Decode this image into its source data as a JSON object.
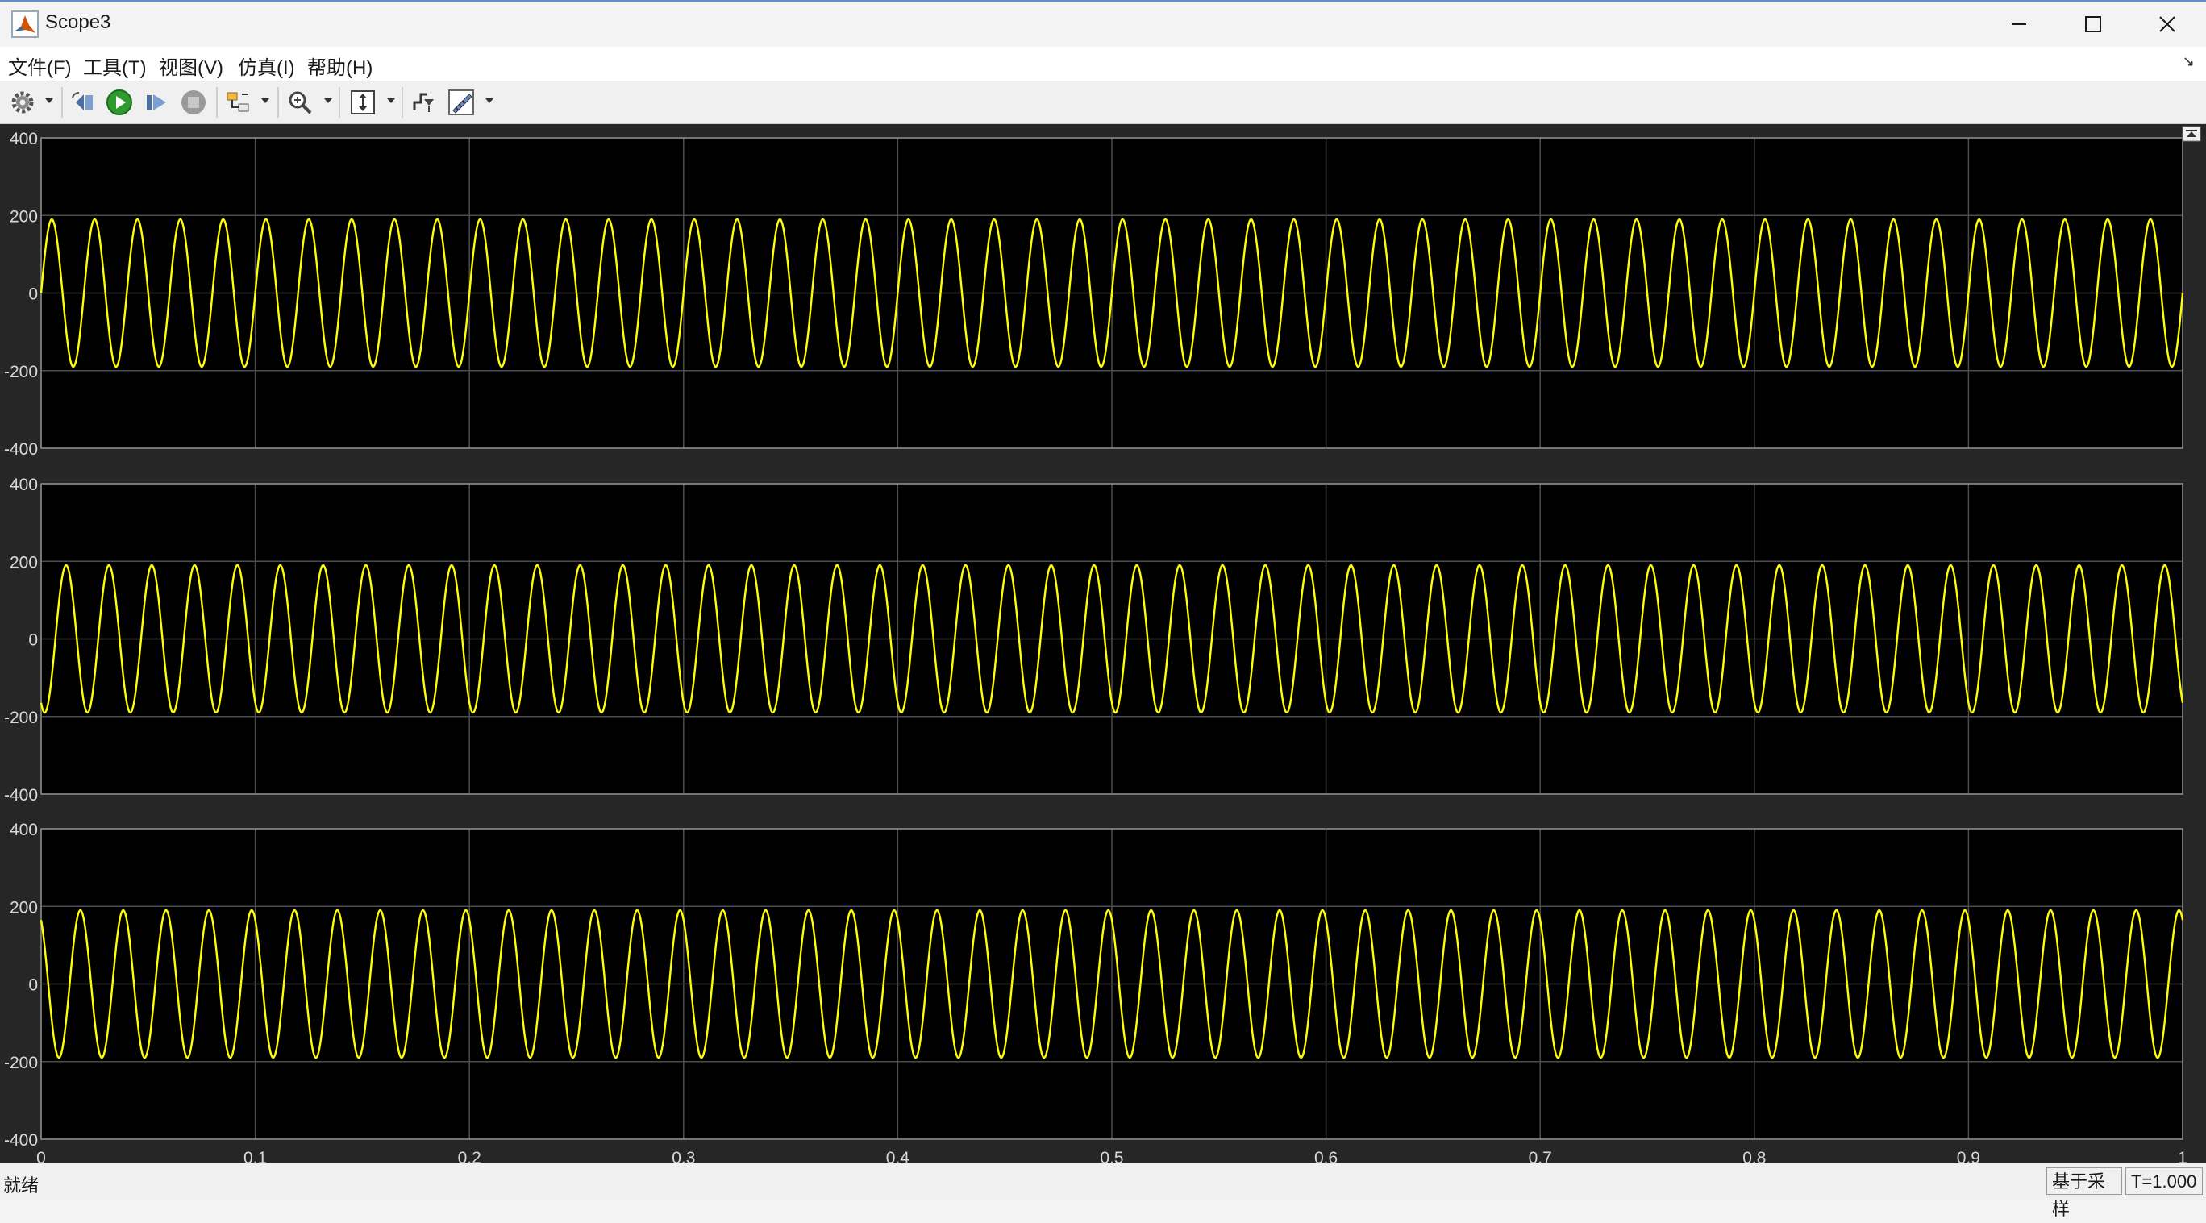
{
  "window": {
    "title": "Scope3"
  },
  "menu": {
    "items": [
      "文件(F)",
      "工具(T)",
      "视图(V)",
      "仿真(I)",
      "帮助(H)"
    ]
  },
  "toolbar": {
    "icons": [
      "settings-icon",
      "step-back-icon",
      "run-icon",
      "step-forward-icon",
      "stop-icon",
      "highlight-simulink-block-icon",
      "zoom-in-icon",
      "autoscale-icon",
      "triggers-icon",
      "measurements-icon"
    ]
  },
  "status": {
    "text": "就绪",
    "mode": "基于采样",
    "time": "T=1.000"
  },
  "colors": {
    "plot_bg": "#000000",
    "figure_bg": "#262626",
    "trace": "#ffff00",
    "grid": "#4d4d4d",
    "tick_text": "#d9d9d9"
  },
  "chart_data": [
    {
      "type": "line",
      "xlim": [
        0,
        1
      ],
      "ylim": [
        -400,
        400
      ],
      "x_ticks": [
        "0",
        "0.1",
        "0.2",
        "0.3",
        "0.4",
        "0.5",
        "0.6",
        "0.7",
        "0.8",
        "0.9",
        "1"
      ],
      "y_ticks": [
        "400",
        "200",
        "0",
        "-200",
        "-400"
      ],
      "show_x_tick_labels": false,
      "grid": true,
      "series": [
        {
          "function": "sine",
          "amplitude": 190,
          "frequency_hz": 50,
          "phase_deg": 0
        }
      ]
    },
    {
      "type": "line",
      "xlim": [
        0,
        1
      ],
      "ylim": [
        -400,
        400
      ],
      "x_ticks": [
        "0",
        "0.1",
        "0.2",
        "0.3",
        "0.4",
        "0.5",
        "0.6",
        "0.7",
        "0.8",
        "0.9",
        "1"
      ],
      "y_ticks": [
        "400",
        "200",
        "0",
        "-200",
        "-400"
      ],
      "show_x_tick_labels": false,
      "grid": true,
      "series": [
        {
          "function": "sine",
          "amplitude": 190,
          "frequency_hz": 50,
          "phase_deg": -120
        }
      ]
    },
    {
      "type": "line",
      "xlim": [
        0,
        1
      ],
      "ylim": [
        -400,
        400
      ],
      "x_ticks": [
        "0",
        "0.1",
        "0.2",
        "0.3",
        "0.4",
        "0.5",
        "0.6",
        "0.7",
        "0.8",
        "0.9",
        "1"
      ],
      "y_ticks": [
        "400",
        "200",
        "0",
        "-200",
        "-400"
      ],
      "show_x_tick_labels": true,
      "grid": true,
      "series": [
        {
          "function": "sine",
          "amplitude": 190,
          "frequency_hz": 50,
          "phase_deg": 120
        }
      ]
    }
  ]
}
